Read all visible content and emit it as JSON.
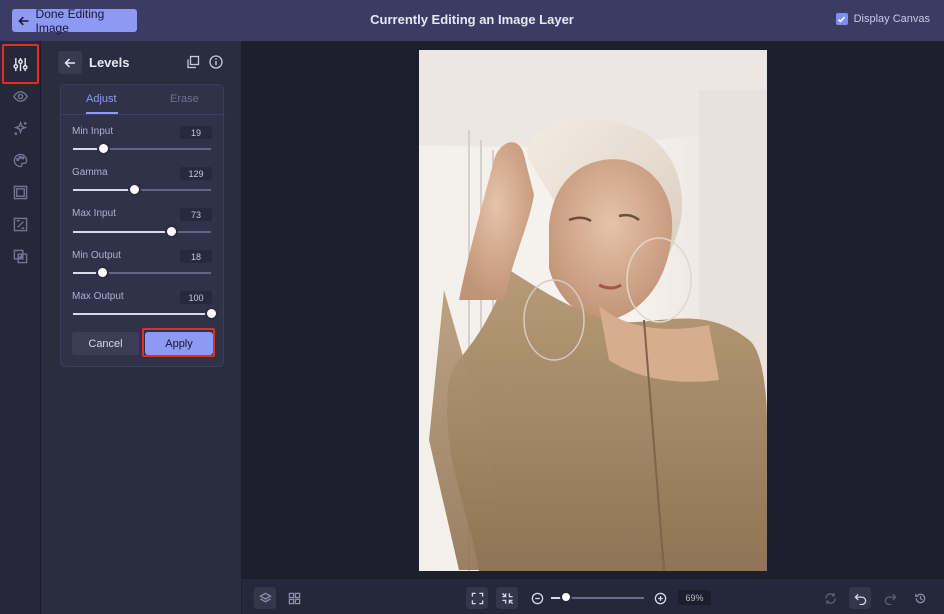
{
  "header": {
    "back_label": "Done Editing Image",
    "title": "Currently Editing an Image Layer",
    "display_canvas_label": "Display Canvas",
    "display_canvas_checked": true
  },
  "rail": {
    "items": [
      "adjust-sliders-icon",
      "eye-icon",
      "sparkle-icon",
      "palette-icon",
      "frame-icon",
      "crop-icon",
      "layers-intersect-icon"
    ],
    "active_index": 0
  },
  "panel": {
    "title": "Levels",
    "tabs": [
      {
        "label": "Adjust",
        "active": true
      },
      {
        "label": "Erase",
        "active": false
      }
    ],
    "sliders": [
      {
        "label": "Min Input",
        "value": "19",
        "fraction": 0.22
      },
      {
        "label": "Gamma",
        "value": "129",
        "fraction": 0.44
      },
      {
        "label": "Max Input",
        "value": "73",
        "fraction": 0.71
      },
      {
        "label": "Min Output",
        "value": "18",
        "fraction": 0.21
      },
      {
        "label": "Max Output",
        "value": "100",
        "fraction": 1.0
      }
    ],
    "cancel_label": "Cancel",
    "apply_label": "Apply"
  },
  "bottom_bar": {
    "zoom_value": "69%",
    "zoom_fraction": 0.16
  },
  "colors": {
    "accent": "#8d99f3",
    "highlight_outline": "#e22f22",
    "topbar": "#3a3c63",
    "panel": "#2a2c3f",
    "canvas_bg": "#1e1f2e"
  }
}
